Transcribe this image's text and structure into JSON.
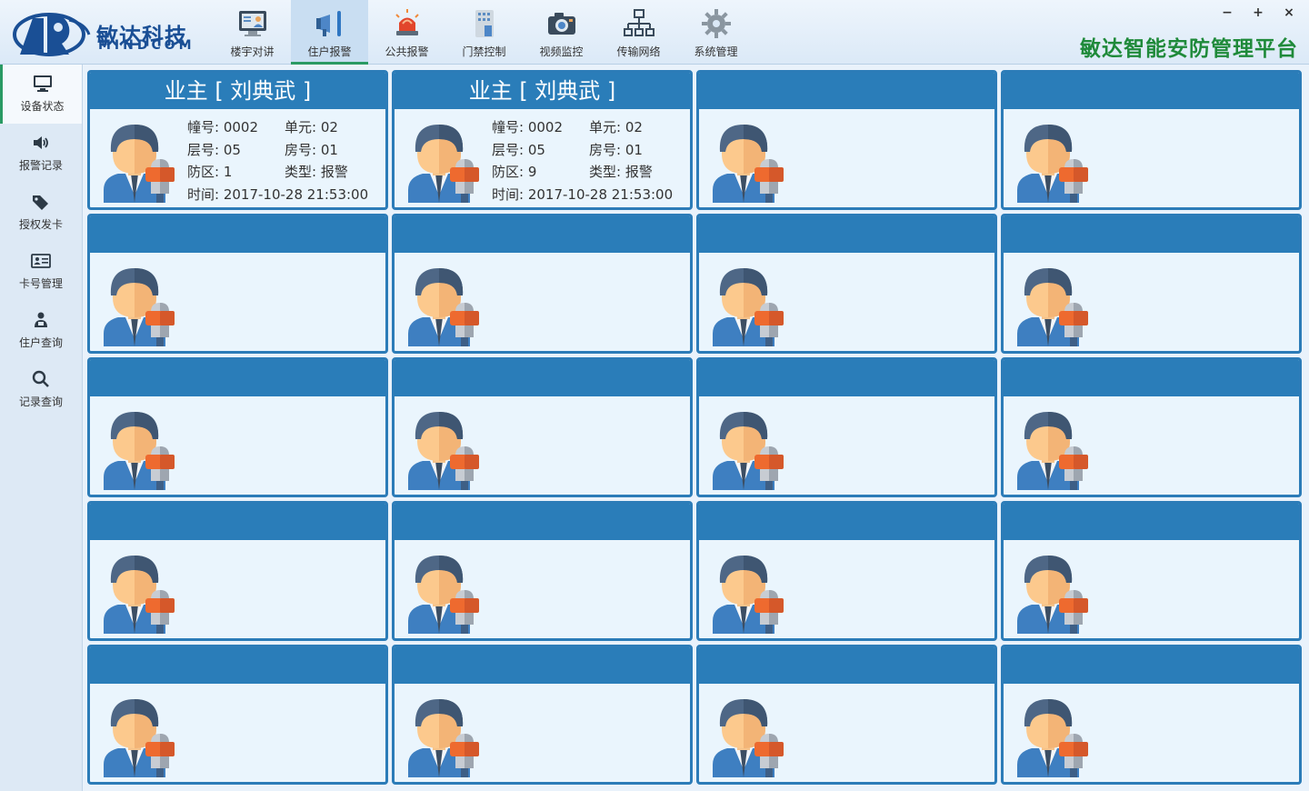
{
  "brand": {
    "name_cn": "敏达科技",
    "name_en": "MINDCOM",
    "platform_title": "敏达智能安防管理平台"
  },
  "window_controls": {
    "minimize": "−",
    "maximize": "+",
    "close": "×"
  },
  "nav": {
    "items": [
      {
        "label": "楼宇对讲",
        "icon": "monitor-intercom-icon",
        "active": false
      },
      {
        "label": "住户报警",
        "icon": "megaphone-icon",
        "active": true
      },
      {
        "label": "公共报警",
        "icon": "alarm-siren-icon",
        "active": false
      },
      {
        "label": "门禁控制",
        "icon": "door-access-icon",
        "active": false
      },
      {
        "label": "视频监控",
        "icon": "camera-icon",
        "active": false
      },
      {
        "label": "传输网络",
        "icon": "network-icon",
        "active": false
      },
      {
        "label": "系统管理",
        "icon": "gear-icon",
        "active": false
      }
    ]
  },
  "sidebar": {
    "items": [
      {
        "label": "设备状态",
        "icon": "monitor-icon",
        "active": true
      },
      {
        "label": "报警记录",
        "icon": "speaker-icon",
        "active": false
      },
      {
        "label": "授权发卡",
        "icon": "tag-icon",
        "active": false
      },
      {
        "label": "卡号管理",
        "icon": "id-card-icon",
        "active": false
      },
      {
        "label": "住户查询",
        "icon": "resident-icon",
        "active": false
      },
      {
        "label": "记录查询",
        "icon": "search-icon",
        "active": false
      }
    ]
  },
  "cards": [
    {
      "title": "业主 [ 刘典武 ]",
      "building_label": "幢号: 0002",
      "unit_label": "单元: 02",
      "floor_label": "层号: 05",
      "room_label": "房号: 01",
      "zone_label": "防区: 1",
      "type_label": "类型: 报警",
      "time_label": "时间: 2017-10-28 21:53:00"
    },
    {
      "title": "业主 [ 刘典武 ]",
      "building_label": "幢号: 0002",
      "unit_label": "单元: 02",
      "floor_label": "层号: 05",
      "room_label": "房号: 01",
      "zone_label": "防区: 9",
      "type_label": "类型: 报警",
      "time_label": "时间: 2017-10-28 21:53:00"
    },
    {},
    {},
    {},
    {},
    {},
    {},
    {},
    {},
    {},
    {},
    {},
    {},
    {},
    {},
    {},
    {},
    {},
    {}
  ],
  "colors": {
    "card_header": "#2a7db9",
    "card_border": "#2c7cb8",
    "card_body": "#eaf5fd",
    "platform_title": "#1f8a3a",
    "active_indicator": "#2a9a64"
  }
}
